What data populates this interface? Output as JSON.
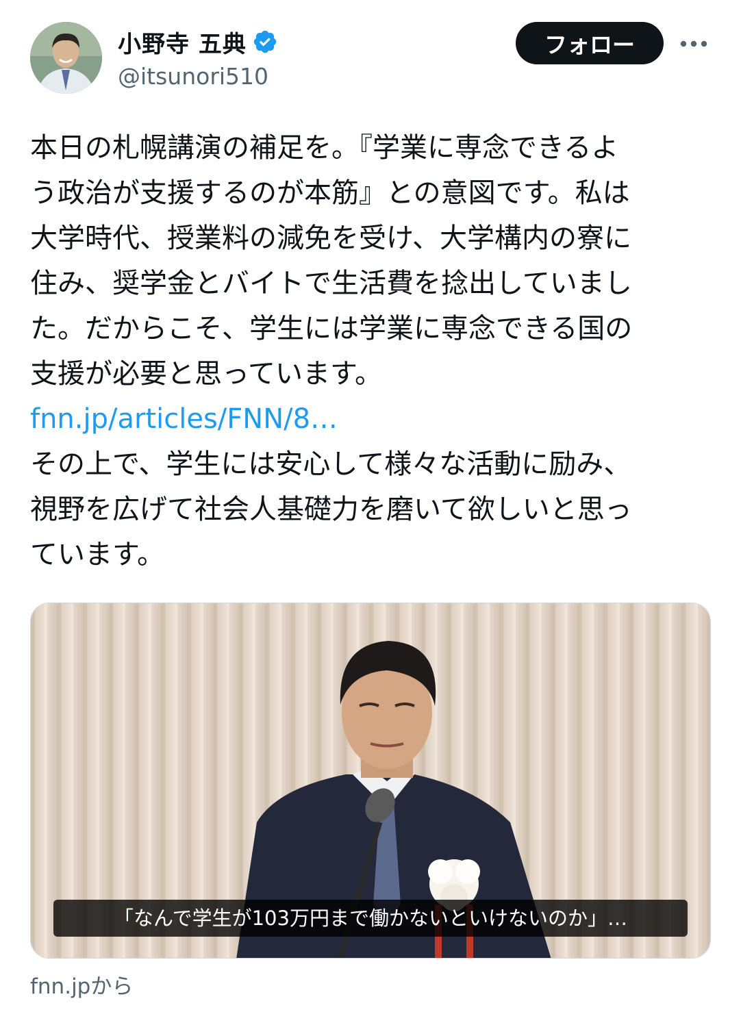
{
  "author": {
    "display_name": "小野寺 五典",
    "handle": "@itsunori510",
    "verified": true,
    "avatar_icon": "avatar-photo"
  },
  "actions": {
    "follow_label": "フォロー",
    "more_icon": "more-horizontal-icon"
  },
  "tweet": {
    "lines": [
      "本日の札幌講演の補足を。『学業に専念できるよ",
      "う政治が支援するのが本筋』との意図です。私は",
      "大学時代、授業料の減免を受け、大学構内の寮に",
      "住み、奨学金とバイトで生活費を捻出していまし",
      "た。だからこそ、学生には学業に専念できる国の",
      "支援が必要と思っています。"
    ],
    "link": "fnn.jp/articles/FNN/8…",
    "lines_after": [
      "その上で、学生には安心して様々な活動に励み、",
      "視野を広げて社会人基礎力を磨いて欲しいと思っ",
      "ています。"
    ]
  },
  "card": {
    "caption": "「なんで学生が103万円まで働かないといけないのか」…",
    "source": "fnn.jpから"
  },
  "colors": {
    "text": "#0f1419",
    "secondary": "#536471",
    "link": "#1d9bf0",
    "verified_badge": "#1d9bf0"
  }
}
